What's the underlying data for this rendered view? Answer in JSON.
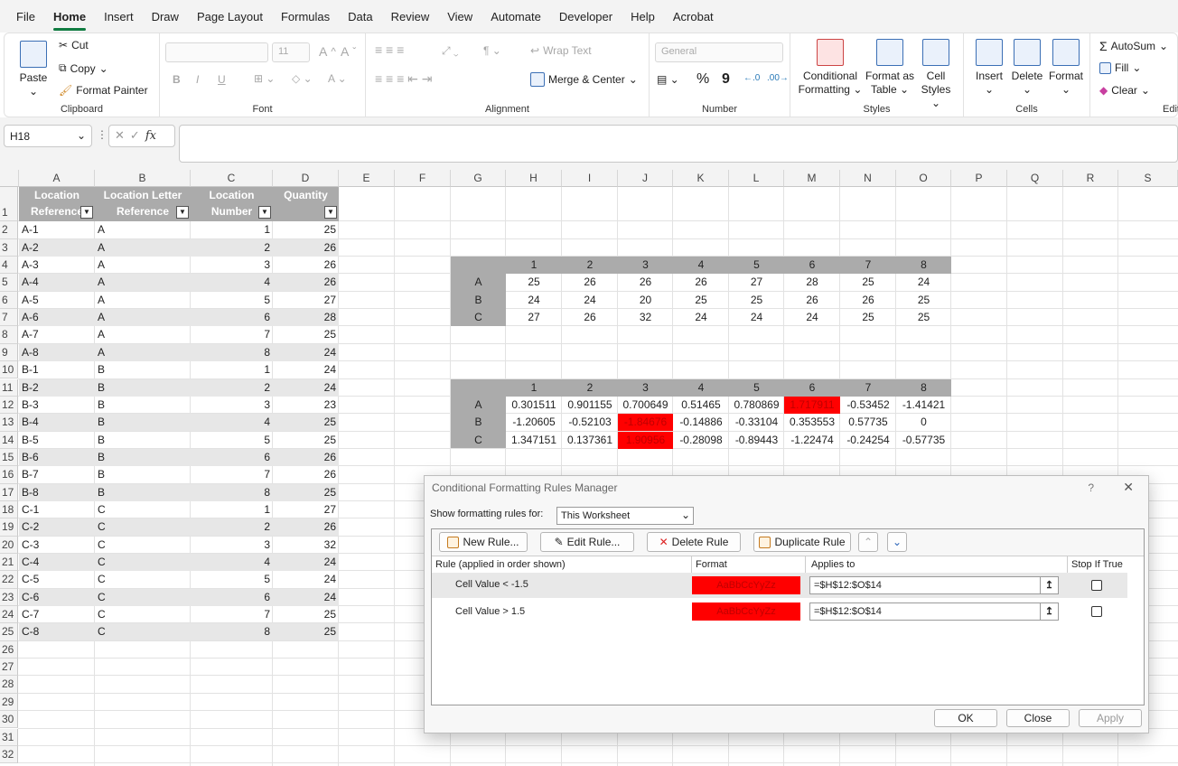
{
  "menu": [
    "File",
    "Home",
    "Insert",
    "Draw",
    "Page Layout",
    "Formulas",
    "Data",
    "Review",
    "View",
    "Automate",
    "Developer",
    "Help",
    "Acrobat"
  ],
  "ribbon": {
    "paste": "Paste",
    "cut": "Cut",
    "copy": "Copy",
    "format_painter": "Format Painter",
    "clipboard": "Clipboard",
    "font_size": "11",
    "font_group": "Font",
    "bold": "B",
    "italic": "I",
    "underline": "U",
    "inc_font": "A^",
    "dec_font": "Aˇ",
    "wrap_text": "Wrap Text",
    "merge_center": "Merge & Center",
    "alignment": "Alignment",
    "number_format": "General",
    "percent": "%",
    "comma": "9",
    "number": "Number",
    "cond_fmt_1": "Conditional",
    "cond_fmt_2": "Formatting",
    "fmt_table_1": "Format as",
    "fmt_table_2": "Table",
    "cell_styles_1": "Cell",
    "cell_styles_2": "Styles",
    "styles": "Styles",
    "insert": "Insert",
    "delete": "Delete",
    "format": "Format",
    "cells": "Cells",
    "autosum": "AutoSum",
    "fill": "Fill",
    "clear": "Clear",
    "editing": "Edit"
  },
  "formula": {
    "name_box": "H18",
    "fx": "fx"
  },
  "columns": [
    "A",
    "B",
    "C",
    "D",
    "E",
    "F",
    "G",
    "H",
    "I",
    "J",
    "K",
    "L",
    "M",
    "N",
    "O",
    "P",
    "Q",
    "R",
    "S"
  ],
  "rows": [
    "1",
    "2",
    "3",
    "4",
    "5",
    "6",
    "7",
    "8",
    "9",
    "10",
    "11",
    "12",
    "13",
    "14",
    "15",
    "16",
    "17",
    "18",
    "19",
    "20",
    "21",
    "22",
    "23",
    "24",
    "25",
    "26",
    "27",
    "28",
    "29",
    "30",
    "31",
    "32"
  ],
  "table": {
    "headers": [
      [
        "Location",
        "Reference"
      ],
      [
        "Location Letter",
        "Reference"
      ],
      [
        "Location",
        "Number"
      ],
      [
        "Quantity",
        ""
      ]
    ],
    "data": [
      [
        "A-1",
        "A",
        "1",
        "25"
      ],
      [
        "A-2",
        "A",
        "2",
        "26"
      ],
      [
        "A-3",
        "A",
        "3",
        "26"
      ],
      [
        "A-4",
        "A",
        "4",
        "26"
      ],
      [
        "A-5",
        "A",
        "5",
        "27"
      ],
      [
        "A-6",
        "A",
        "6",
        "28"
      ],
      [
        "A-7",
        "A",
        "7",
        "25"
      ],
      [
        "A-8",
        "A",
        "8",
        "24"
      ],
      [
        "B-1",
        "B",
        "1",
        "24"
      ],
      [
        "B-2",
        "B",
        "2",
        "24"
      ],
      [
        "B-3",
        "B",
        "3",
        "23"
      ],
      [
        "B-4",
        "B",
        "4",
        "25"
      ],
      [
        "B-5",
        "B",
        "5",
        "25"
      ],
      [
        "B-6",
        "B",
        "6",
        "26"
      ],
      [
        "B-7",
        "B",
        "7",
        "26"
      ],
      [
        "B-8",
        "B",
        "8",
        "25"
      ],
      [
        "C-1",
        "C",
        "1",
        "27"
      ],
      [
        "C-2",
        "C",
        "2",
        "26"
      ],
      [
        "C-3",
        "C",
        "3",
        "32"
      ],
      [
        "C-4",
        "C",
        "4",
        "24"
      ],
      [
        "C-5",
        "C",
        "5",
        "24"
      ],
      [
        "C-6",
        "C",
        "6",
        "24"
      ],
      [
        "C-7",
        "C",
        "7",
        "25"
      ],
      [
        "C-8",
        "C",
        "8",
        "25"
      ]
    ]
  },
  "pivot1": {
    "cols": [
      "1",
      "2",
      "3",
      "4",
      "5",
      "6",
      "7",
      "8"
    ],
    "rows": [
      {
        "label": "A",
        "values": [
          "25",
          "26",
          "26",
          "26",
          "27",
          "28",
          "25",
          "24"
        ]
      },
      {
        "label": "B",
        "values": [
          "24",
          "24",
          "20",
          "25",
          "25",
          "26",
          "26",
          "25"
        ]
      },
      {
        "label": "C",
        "values": [
          "27",
          "26",
          "32",
          "24",
          "24",
          "24",
          "25",
          "25"
        ]
      }
    ]
  },
  "pivot2": {
    "cols": [
      "1",
      "2",
      "3",
      "4",
      "5",
      "6",
      "7",
      "8"
    ],
    "rows": [
      {
        "label": "A",
        "values": [
          "0.301511",
          "0.901155",
          "0.700649",
          "0.51465",
          "0.780869",
          "1.717911",
          "-0.53452",
          "-1.41421"
        ],
        "red": [
          false,
          false,
          false,
          false,
          false,
          true,
          false,
          false
        ]
      },
      {
        "label": "B",
        "values": [
          "-1.20605",
          "-0.52103",
          "-1.84676",
          "-0.14886",
          "-0.33104",
          "0.353553",
          "0.57735",
          "0"
        ],
        "red": [
          false,
          false,
          true,
          false,
          false,
          false,
          false,
          false
        ]
      },
      {
        "label": "C",
        "values": [
          "1.347151",
          "0.137361",
          "1.90956",
          "-0.28098",
          "-0.89443",
          "-1.22474",
          "-0.24254",
          "-0.57735"
        ],
        "red": [
          false,
          false,
          true,
          false,
          false,
          false,
          false,
          false
        ]
      }
    ]
  },
  "dialog": {
    "title": "Conditional Formatting Rules Manager",
    "help": "?",
    "close_x": "✕",
    "show_label": "Show formatting rules for:",
    "scope": "This Worksheet",
    "new_rule": "New Rule...",
    "edit_rule": "Edit Rule...",
    "delete_rule": "Delete Rule",
    "duplicate_rule": "Duplicate Rule",
    "col_rule": "Rule (applied in order shown)",
    "col_format": "Format",
    "col_applies": "Applies to",
    "col_stop": "Stop If True",
    "rules": [
      {
        "rule": "Cell Value < -1.5",
        "format": "AaBbCcYyZz",
        "applies": "=$H$12:$O$14"
      },
      {
        "rule": "Cell Value > 1.5",
        "format": "AaBbCcYyZz",
        "applies": "=$H$12:$O$14"
      }
    ],
    "ok": "OK",
    "close": "Close",
    "apply": "Apply"
  }
}
